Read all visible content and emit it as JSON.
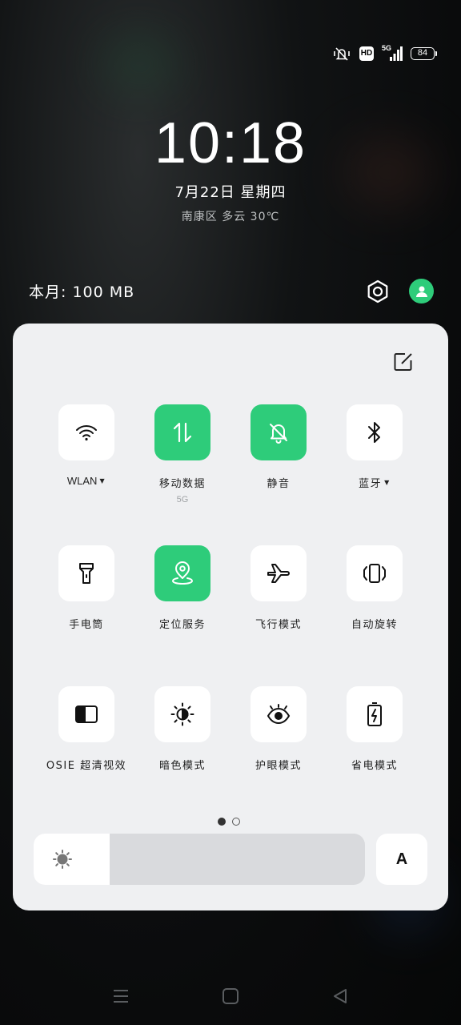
{
  "status_bar": {
    "icons": [
      "vibrate-mute-icon",
      "hd-icon",
      "signal-5g-icon",
      "battery-icon"
    ],
    "hd_label": "HD",
    "network_label": "5G",
    "battery_level": "84"
  },
  "lockscreen": {
    "time": "10:18",
    "date": "7月22日 星期四",
    "weather": "南康区 多云 30℃",
    "data_usage": "本月: 100 MB"
  },
  "panel": {
    "tiles": [
      {
        "label": "WLAN",
        "sub": "",
        "active": false,
        "dropdown": true,
        "icon": "wifi-icon"
      },
      {
        "label": "移动数据",
        "sub": "5G",
        "active": true,
        "dropdown": false,
        "icon": "mobile-data-icon"
      },
      {
        "label": "静音",
        "sub": "",
        "active": true,
        "dropdown": false,
        "icon": "bell-mute-icon"
      },
      {
        "label": "蓝牙",
        "sub": "",
        "active": false,
        "dropdown": true,
        "icon": "bluetooth-icon"
      },
      {
        "label": "手电筒",
        "sub": "",
        "active": false,
        "dropdown": false,
        "icon": "flashlight-icon"
      },
      {
        "label": "定位服务",
        "sub": "",
        "active": true,
        "dropdown": false,
        "icon": "location-icon"
      },
      {
        "label": "飞行模式",
        "sub": "",
        "active": false,
        "dropdown": false,
        "icon": "airplane-icon"
      },
      {
        "label": "自动旋转",
        "sub": "",
        "active": false,
        "dropdown": false,
        "icon": "auto-rotate-icon"
      },
      {
        "label": "OSIE 超清视效",
        "sub": "",
        "active": false,
        "dropdown": false,
        "icon": "osie-icon"
      },
      {
        "label": "暗色模式",
        "sub": "",
        "active": false,
        "dropdown": false,
        "icon": "dark-mode-icon"
      },
      {
        "label": "护眼模式",
        "sub": "",
        "active": false,
        "dropdown": false,
        "icon": "eye-icon"
      },
      {
        "label": "省电模式",
        "sub": "",
        "active": false,
        "dropdown": false,
        "icon": "battery-saver-icon"
      }
    ],
    "page_indicator": {
      "current": 1,
      "total": 2
    },
    "brightness_level": 0.23,
    "auto_brightness_label": "A"
  },
  "colors": {
    "accent": "#2ecc7a",
    "panel_bg": "#eff0f2",
    "tile_bg": "#ffffff"
  },
  "nav_bar": {
    "buttons": [
      "menu-icon",
      "home-icon",
      "back-icon"
    ]
  }
}
